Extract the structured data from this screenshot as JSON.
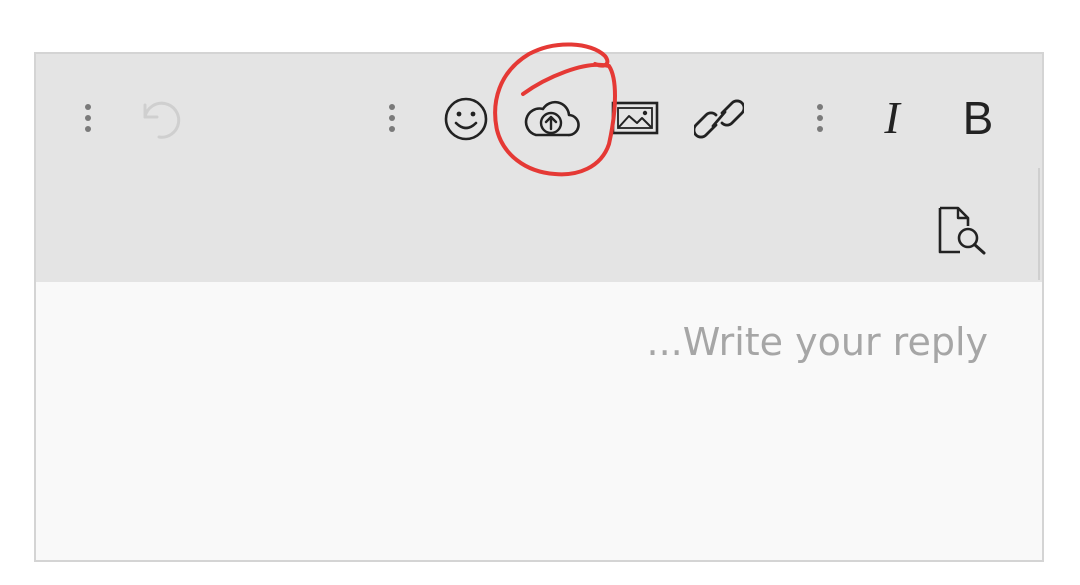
{
  "toolbar": {
    "more_icon": "vertical-dots-icon",
    "undo_icon": "undo-icon",
    "emoji_icon": "smiley-icon",
    "upload_icon": "cloud-upload-icon",
    "image_icon": "image-icon",
    "link_icon": "link-icon",
    "italic_label": "I",
    "bold_label": "B",
    "preview_icon": "document-search-icon"
  },
  "reply": {
    "placeholder": "...Write your reply"
  },
  "annotation": {
    "color": "#e53935"
  },
  "colors": {
    "toolbar_bg": "#e4e4e4",
    "editor_bg": "#f9f9f9",
    "icon": "#222222",
    "icon_disabled": "#cfcfcf",
    "placeholder": "#a6a6a6"
  }
}
